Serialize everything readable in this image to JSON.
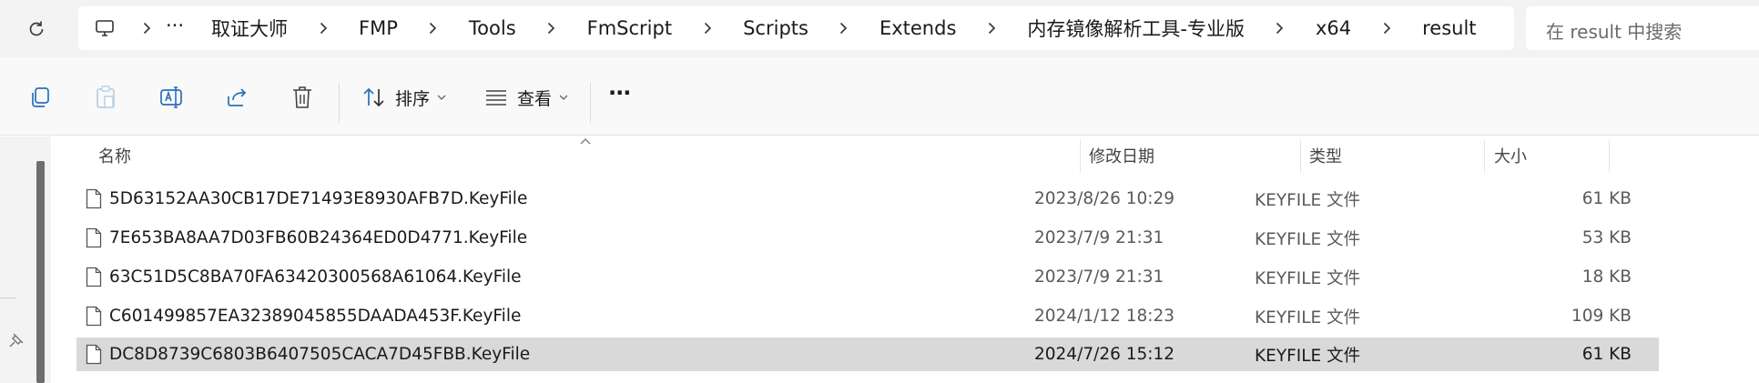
{
  "address_bar": {
    "breadcrumbs": [
      "取证大师",
      "FMP",
      "Tools",
      "FmScript",
      "Scripts",
      "Extends",
      "内存镜像解析工具-专业版",
      "x64",
      "result"
    ],
    "overflow_glyph": "···",
    "search_placeholder": "在 result 中搜索"
  },
  "toolbar": {
    "sort_label": "排序",
    "view_label": "查看",
    "more_glyph": "···"
  },
  "columns": {
    "name": "名称",
    "date": "修改日期",
    "type": "类型",
    "size": "大小"
  },
  "files": [
    {
      "name": "5D63152AA30CB17DE71493E8930AFB7D.KeyFile",
      "date": "2023/8/26 10:29",
      "type": "KEYFILE 文件",
      "size": "61 KB",
      "selected": false
    },
    {
      "name": "7E653BA8AA7D03FB60B24364ED0D4771.KeyFile",
      "date": "2023/7/9 21:31",
      "type": "KEYFILE 文件",
      "size": "53 KB",
      "selected": false
    },
    {
      "name": "63C51D5C8BA70FA63420300568A61064.KeyFile",
      "date": "2023/7/9 21:31",
      "type": "KEYFILE 文件",
      "size": "18 KB",
      "selected": false
    },
    {
      "name": "C601499857EA32389045855DAADA453F.KeyFile",
      "date": "2024/1/12 18:23",
      "type": "KEYFILE 文件",
      "size": "109 KB",
      "selected": false
    },
    {
      "name": "DC8D8739C6803B6407505CACA7D45FBB.KeyFile",
      "date": "2024/7/26 15:12",
      "type": "KEYFILE 文件",
      "size": "61 KB",
      "selected": true
    }
  ],
  "colors": {
    "accent_icon": "#2a6ebd",
    "selected_row": "#d9d9d9"
  },
  "icons": {
    "refresh": "refresh-icon",
    "computer": "computer-icon",
    "copy": "copy-icon",
    "paste": "paste-icon",
    "rename": "rename-icon",
    "share": "share-icon",
    "delete": "delete-icon",
    "sort": "sort-icon",
    "view": "view-icon",
    "file": "file-icon",
    "pin": "pin-icon"
  }
}
